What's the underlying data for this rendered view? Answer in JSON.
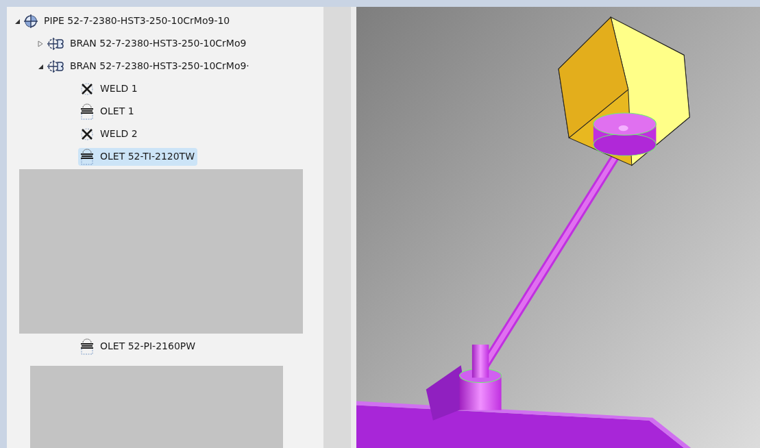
{
  "tree": [
    {
      "kind": "pipe",
      "label": "PIPE 52-7-2380-HST3-250-10CrMo9-10",
      "expanded": true,
      "selected": false,
      "children": [
        {
          "kind": "bran",
          "label": "BRAN 52-7-2380-HST3-250-10CrMo9",
          "expanded": false,
          "selected": false
        },
        {
          "kind": "bran",
          "label": "BRAN 52-7-2380-HST3-250-10CrMo9·",
          "expanded": true,
          "selected": false,
          "children": [
            {
              "kind": "weld",
              "label": "WELD 1",
              "selected": false
            },
            {
              "kind": "olet",
              "label": "OLET 1",
              "selected": false
            },
            {
              "kind": "weld",
              "label": "WELD 2",
              "selected": false
            },
            {
              "kind": "olet",
              "label": "OLET 52-TI-2120TW",
              "selected": true
            },
            {
              "kind": "redacted"
            },
            {
              "kind": "olet",
              "label": "OLET 52-PI-2160PW",
              "selected": false
            },
            {
              "kind": "redacted"
            }
          ]
        }
      ]
    }
  ],
  "viewport": {
    "kind": "model"
  }
}
